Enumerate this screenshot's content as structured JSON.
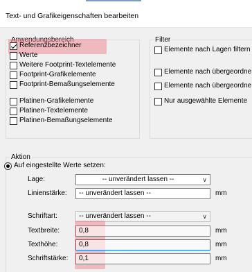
{
  "window": {
    "title": "Text- und Grafikeigenschaften bearbeiten"
  },
  "anwendungsbereich": {
    "legend": "Anwendungsbereich",
    "items": [
      {
        "label": "Referenzbezeichner",
        "checked": true
      },
      {
        "label": "Werte",
        "checked": false
      },
      {
        "label": "Weitere Footprint-Textelemente",
        "checked": false
      },
      {
        "label": "Footprint-Grafikelemente",
        "checked": false
      },
      {
        "label": "Footprint-Bemaßungselemente",
        "checked": false
      },
      {
        "label": "Platinen-Grafikelemente",
        "checked": false
      },
      {
        "label": "Platinen-Textelemente",
        "checked": false
      },
      {
        "label": "Platinen-Bemaßungselemente",
        "checked": false
      }
    ]
  },
  "filter": {
    "legend": "Filter",
    "items": [
      {
        "label": "Elemente nach Lagen filtern",
        "checked": false
      },
      {
        "label": "Elemente nach übergeordne",
        "checked": false
      },
      {
        "label": "Elemente nach übergeordne",
        "checked": false
      },
      {
        "label": "Nur ausgewählte Elemente",
        "checked": false
      }
    ]
  },
  "aktion": {
    "legend": "Aktion",
    "radio_label": "Auf eingestellte Werte setzen:",
    "lage_label": "Lage:",
    "lage_value": "-- unverändert lassen --",
    "linienstaerke_label": "Linienstärke:",
    "linienstaerke_value": "-- unverändert lassen --",
    "linienstaerke_unit": "mm",
    "schriftart_label": "Schriftart:",
    "schriftart_value": "-- unverändert lassen --",
    "textbreite_label": "Textbreite:",
    "textbreite_value": "0,8",
    "textbreite_unit": "mm",
    "texthoehe_label": "Texthöhe:",
    "texthoehe_value": "0,8",
    "texthoehe_unit": "mm",
    "schriftstaerke_label": "Schriftstärke:",
    "schriftstaerke_value": "0,1",
    "schriftstaerke_unit": "mm"
  },
  "icons": {
    "chevron": "chevron-down-icon"
  },
  "colors": {
    "highlight": "#eb7882",
    "focus": "#0078d7"
  }
}
